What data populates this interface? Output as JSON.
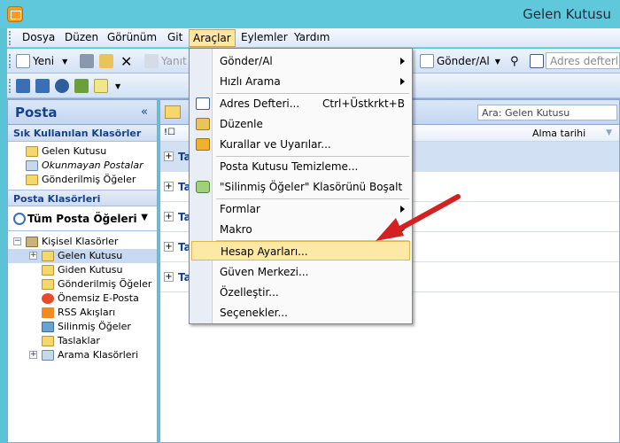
{
  "window": {
    "title": "Gelen Kutusu"
  },
  "menubar": {
    "items": [
      {
        "label": "Dosya"
      },
      {
        "label": "Düzen"
      },
      {
        "label": "Görünüm"
      },
      {
        "label": "Git"
      },
      {
        "label": "Araçlar"
      },
      {
        "label": "Eylemler"
      },
      {
        "label": "Yardım"
      }
    ]
  },
  "toolbar": {
    "new_label": "Yeni",
    "reply_label": "Yanıt",
    "send_receive_label": "Gönder/Al",
    "address_book_placeholder": "Adres defterle"
  },
  "nav": {
    "title": "Posta",
    "collapse": "«",
    "favorites_header": "Sık Kullanılan Klasörler",
    "favorites": [
      {
        "label": "Gelen Kutusu",
        "icon": "folder-icon"
      },
      {
        "label": "Okunmayan Postalar",
        "icon": "search-folder-icon"
      },
      {
        "label": "Gönderilmiş Öğeler",
        "icon": "folder-icon"
      }
    ],
    "mail_folders_header": "Posta Klasörleri",
    "all_mail": "Tüm Posta Öğeleri",
    "tree": [
      {
        "label": "Kişisel Klasörler",
        "icon": "personal-folders-icon",
        "expander": "−"
      },
      {
        "label": "Gelen Kutusu",
        "icon": "inbox-icon",
        "expander": "+"
      },
      {
        "label": "Giden Kutusu",
        "icon": "outbox-icon",
        "expander": ""
      },
      {
        "label": "Gönderilmiş Öğeler",
        "icon": "sent-icon",
        "expander": ""
      },
      {
        "label": "Önemsiz E-Posta",
        "icon": "junk-icon",
        "expander": ""
      },
      {
        "label": "RSS Akışları",
        "icon": "rss-icon",
        "expander": ""
      },
      {
        "label": "Silinmiş Öğeler",
        "icon": "deleted-icon",
        "expander": ""
      },
      {
        "label": "Taslaklar",
        "icon": "drafts-icon",
        "expander": ""
      },
      {
        "label": "Arama Klasörleri",
        "icon": "search-folder-icon",
        "expander": "+"
      }
    ]
  },
  "main": {
    "search_placeholder": "Ara: Gelen Kutusu",
    "col_icons": "!☐",
    "col_date": "Alma tarihi",
    "group_rows": [
      "Ta",
      "Ta",
      "Ta",
      "Ta",
      "Ta"
    ]
  },
  "dropdown": {
    "items": [
      {
        "label": "Gönder/Al",
        "shortcut": "",
        "submenu": true,
        "icon": ""
      },
      {
        "label": "Hızlı Arama",
        "shortcut": "",
        "submenu": true,
        "icon": ""
      },
      {
        "label": "Adres Defteri...",
        "shortcut": "Ctrl+Üstkrkt+B",
        "submenu": false,
        "icon": "address-book-icon"
      },
      {
        "label": "Düzenle",
        "shortcut": "",
        "submenu": false,
        "icon": "organize-icon"
      },
      {
        "label": "Kurallar ve Uyarılar...",
        "shortcut": "",
        "submenu": false,
        "icon": "rules-icon"
      },
      {
        "label": "Posta Kutusu Temizleme...",
        "shortcut": "",
        "submenu": false,
        "icon": ""
      },
      {
        "label": "\"Silinmiş Öğeler\" Klasörünü Boşalt",
        "shortcut": "",
        "submenu": false,
        "icon": "recycle-icon"
      },
      {
        "label": "Formlar",
        "shortcut": "",
        "submenu": true,
        "icon": ""
      },
      {
        "label": "Makro",
        "shortcut": "",
        "submenu": true,
        "icon": ""
      },
      {
        "label": "Hesap Ayarları...",
        "shortcut": "",
        "submenu": false,
        "icon": "",
        "highlighted": true
      },
      {
        "label": "Güven Merkezi...",
        "shortcut": "",
        "submenu": false,
        "icon": ""
      },
      {
        "label": "Özelleştir...",
        "shortcut": "",
        "submenu": false,
        "icon": ""
      },
      {
        "label": "Seçenekler...",
        "shortcut": "",
        "submenu": false,
        "icon": ""
      }
    ]
  },
  "colors": {
    "accent": "#15428b",
    "highlight": "#fde9a6",
    "annotation": "#d42020"
  }
}
